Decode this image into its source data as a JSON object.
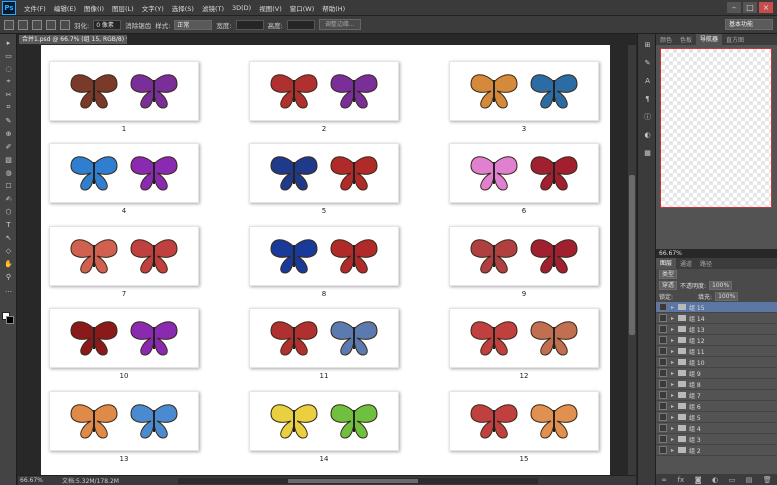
{
  "menubar": {
    "logo": "Ps",
    "items": [
      "文件(F)",
      "编辑(E)",
      "图像(I)",
      "图层(L)",
      "文字(Y)",
      "选择(S)",
      "滤镜(T)",
      "3D(D)",
      "视图(V)",
      "窗口(W)",
      "帮助(H)"
    ],
    "controls": [
      "–",
      "□",
      "×"
    ]
  },
  "options": {
    "feather_label": "羽化:",
    "feather_value": "0 像素",
    "antialias_label": "消除锯齿",
    "style_label": "样式:",
    "style_value": "正常",
    "width_label": "宽度:",
    "height_label": "高度:",
    "refine_button": "调整边缘...",
    "workspace": "基本功能"
  },
  "document": {
    "tab_title": "合并1.psd @ 66.7% (组 15, RGB/8) *",
    "thumb_numbers": [
      "1",
      "2",
      "3",
      "4",
      "5",
      "6",
      "7",
      "8",
      "9",
      "10",
      "11",
      "12",
      "13",
      "14",
      "15"
    ],
    "colors": [
      [
        "#7a3a2a",
        "#7a2e9a"
      ],
      [
        "#b03030",
        "#7a2e9a"
      ],
      [
        "#d48a3a",
        "#2c6ca4"
      ],
      [
        "#2f7fd0",
        "#8a2ab0"
      ],
      [
        "#1f3a8a",
        "#b02a2a"
      ],
      [
        "#e080d0",
        "#a02030"
      ],
      [
        "#d06050",
        "#c04040"
      ],
      [
        "#1a3a9a",
        "#b02a2a"
      ],
      [
        "#b04040",
        "#a02030"
      ],
      [
        "#8a1a1a",
        "#8a2ab0"
      ],
      [
        "#b03030",
        "#5a7ab0"
      ],
      [
        "#c04040",
        "#c07050"
      ],
      [
        "#e08a4a",
        "#4a8ad0"
      ],
      [
        "#e8d040",
        "#70c040"
      ],
      [
        "#c04040",
        "#e09050"
      ]
    ]
  },
  "status": {
    "zoom": "66.67%",
    "doc": "文档:5.32M/178.2M"
  },
  "panels": {
    "top_tabs": [
      "颜色",
      "色板",
      "导航器",
      "直方图"
    ],
    "nav_zoom": "66.67%",
    "layer_tabs": [
      "图层",
      "通道",
      "路径"
    ],
    "kind_label": "类型",
    "blend_mode": "穿透",
    "opacity_label": "不透明度:",
    "opacity_value": "100%",
    "lock_label": "锁定:",
    "fill_label": "填充:",
    "fill_value": "100%",
    "layers": [
      "组 15",
      "组 14",
      "组 13",
      "组 12",
      "组 11",
      "组 10",
      "组 9",
      "组 8",
      "组 7",
      "组 6",
      "组 5",
      "组 4",
      "组 3",
      "组 2"
    ],
    "selected_layer": 0,
    "footer_icons": [
      "∞",
      "fx",
      "◙",
      "◐",
      "▭",
      "▤",
      "🗑"
    ]
  },
  "tools": [
    "▸",
    "▭",
    "◌",
    "⌖",
    "✂",
    "⌗",
    "✎",
    "⊕",
    "✐",
    "▧",
    "◍",
    "☐",
    "✍",
    "⬡",
    "T",
    "↖",
    "◇",
    "✋",
    "⚲",
    "…"
  ]
}
